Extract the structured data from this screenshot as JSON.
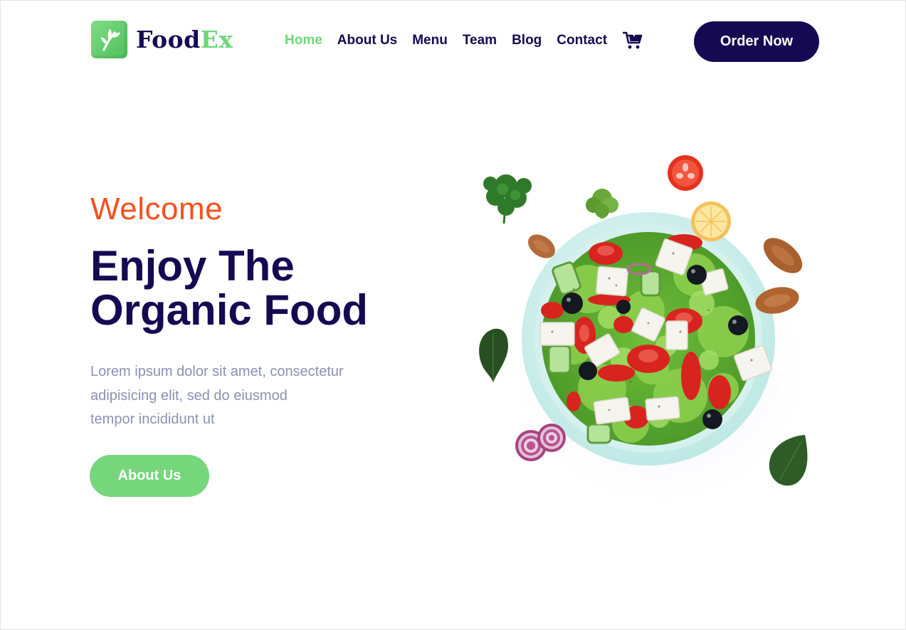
{
  "header": {
    "logo": {
      "icon": "leaf-icon",
      "text_part1": "Food",
      "text_part2": "Ex"
    },
    "nav": {
      "items": [
        {
          "label": "Home",
          "active": true
        },
        {
          "label": "About Us",
          "active": false
        },
        {
          "label": "Menu",
          "active": false
        },
        {
          "label": "Team",
          "active": false
        },
        {
          "label": "Blog",
          "active": false
        },
        {
          "label": "Contact",
          "active": false
        }
      ],
      "cart_icon": "cart-icon"
    },
    "cta_label": "Order Now"
  },
  "hero": {
    "eyebrow": "Welcome",
    "title_line1": "Enjoy The",
    "title_line2": "Organic Food",
    "description_line1": "Lorem ipsum dolor sit amet, consectetur",
    "description_line2": "adipisicing elit, sed do eiusmod",
    "description_line3": "tempor incididunt ut",
    "button_label": "About Us",
    "image": "salad-bowl-image"
  },
  "colors": {
    "primary_dark": "#150a52",
    "accent_green": "#6fd67a",
    "accent_orange": "#f4511e",
    "muted_text": "#8b91b0",
    "background": "#ffffff"
  }
}
